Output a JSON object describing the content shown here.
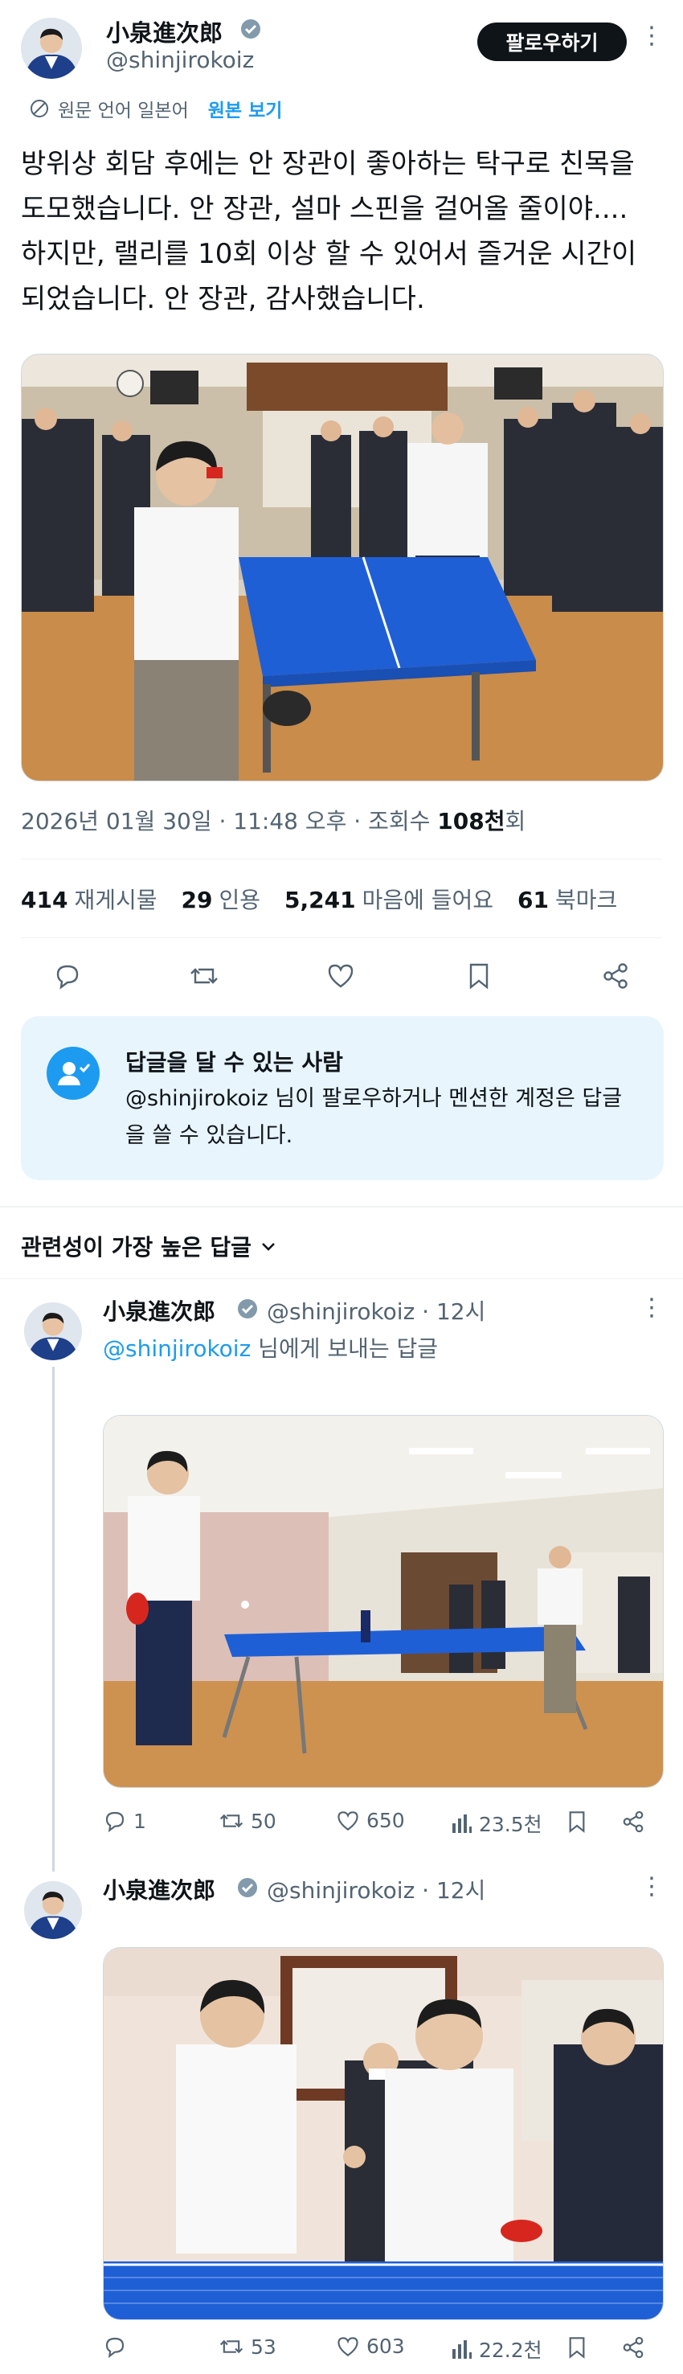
{
  "post": {
    "author_name": "小泉進次郎",
    "author_handle": "@shinjirokoiz",
    "follow_label": "팔로우하기",
    "translate_note": "원문 언어 일본어",
    "translate_link": "원본 보기",
    "text": "방위상 회담 후에는 안 장관이 좋아하는 탁구로 친목을 도모했습니다. 안 장관, 설마 스핀을 걸어올 줄이야.... 하지만, 랠리를 10회 이상 할 수 있어서 즐거운 시간이 되었습니다. 안 장관, 감사했습니다.",
    "date": "2026년 01월 30일 · 11:48 오후 · 조회수 ",
    "views": "108천",
    "views_suffix": "회",
    "stats": {
      "reposts_count": "414",
      "reposts_label": "재게시물",
      "quotes_count": "29",
      "quotes_label": "인용",
      "likes_count": "5,241",
      "likes_label": "마음에 들어요",
      "bookmarks_count": "61",
      "bookmarks_label": "북마크"
    }
  },
  "reply_notice": {
    "title": "답글을 달 수 있는 사람",
    "body": "@shinjirokoiz 님이 팔로우하거나 멘션한 계정은 답글을 쓸 수 있습니다."
  },
  "sort_label": "관련성이 가장 높은 답글",
  "replies": [
    {
      "author_name": "小泉進次郎",
      "author_handle": "@shinjirokoiz · 12시",
      "reply_to_mention": "@shinjirokoiz",
      "reply_to_suffix": " 님에게 보내는 답글",
      "replies": "1",
      "reposts": "50",
      "likes": "650",
      "views": "23.5천"
    },
    {
      "author_name": "小泉進次郎",
      "author_handle": "@shinjirokoiz · 12시",
      "reposts": "53",
      "likes": "603",
      "views": "22.2천"
    }
  ],
  "colors": {
    "accent": "#1d9bf0",
    "text": "#0f1419",
    "muted": "#536471",
    "notice_bg": "#e8f5fd",
    "table_blue": "#1f5fd6"
  }
}
